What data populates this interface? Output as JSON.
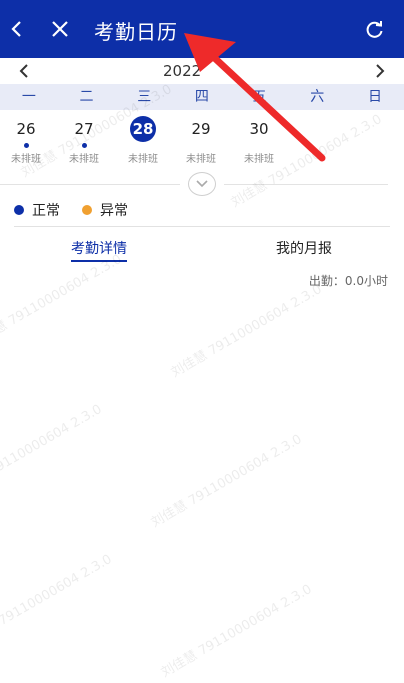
{
  "header": {
    "title": "考勤日历",
    "back_icon": "chevron-left-icon",
    "close_icon": "close-icon",
    "refresh_icon": "refresh-icon",
    "bg_color": "#0d2fa8"
  },
  "calendar": {
    "month_label": "2022",
    "prev_icon": "chevron-left-icon",
    "next_icon": "chevron-right-icon",
    "weekdays": [
      "一",
      "二",
      "三",
      "四",
      "五",
      "六",
      "日"
    ],
    "days": [
      {
        "date": "26",
        "status": "未排班",
        "dot": true,
        "selected": false
      },
      {
        "date": "27",
        "status": "未排班",
        "dot": true,
        "selected": false
      },
      {
        "date": "28",
        "status": "未排班",
        "dot": false,
        "selected": true
      },
      {
        "date": "29",
        "status": "未排班",
        "dot": false,
        "selected": false
      },
      {
        "date": "30",
        "status": "未排班",
        "dot": false,
        "selected": false
      }
    ]
  },
  "legend": [
    {
      "label": "正常",
      "color": "#0d2fa8"
    },
    {
      "label": "异常",
      "color": "#f0a030"
    }
  ],
  "tabs": [
    {
      "label": "考勤详情",
      "active": true
    },
    {
      "label": "我的月报",
      "active": false
    }
  ],
  "summary": "出勤：0.0小时",
  "watermark": "刘佳慧 79110000604 2.3.0"
}
